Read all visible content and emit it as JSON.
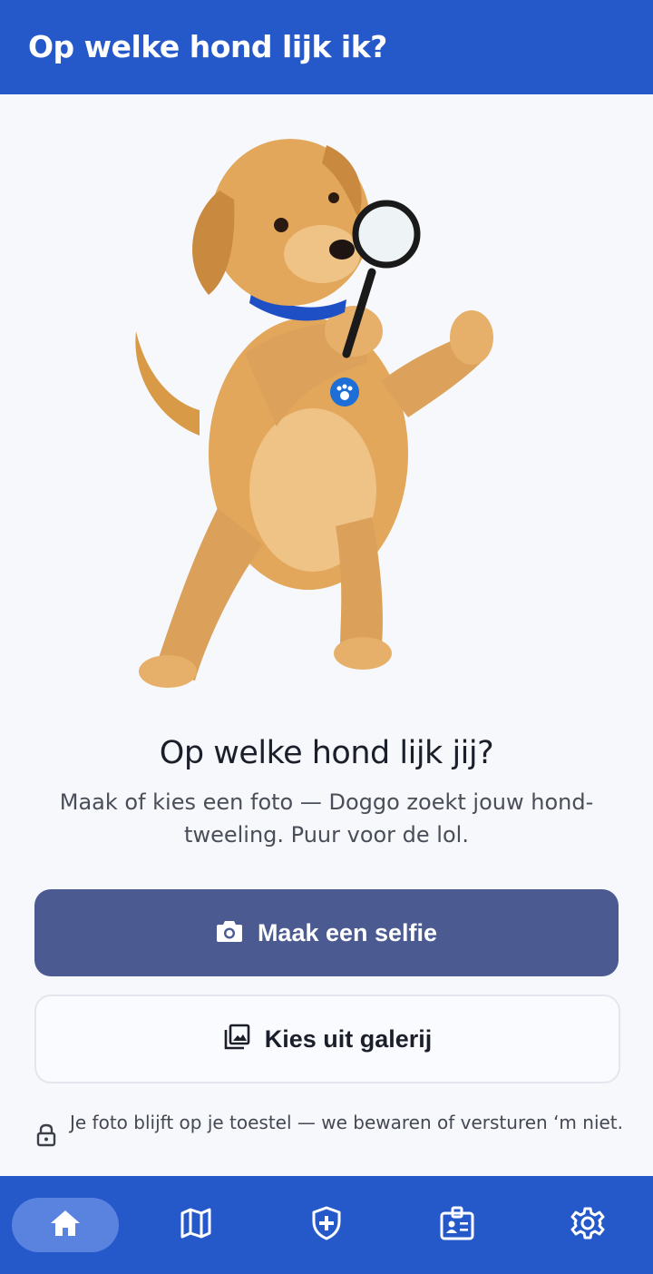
{
  "appbar": {
    "title": "Op welke hond lijk ik?"
  },
  "hero": {
    "image_name": "puppy-with-magnifying-glass"
  },
  "main": {
    "headline": "Op welke hond lijk jij?",
    "subtitle": "Maak of kies een foto — Doggo zoekt jouw hond-tweeling. Puur voor de lol.",
    "primary_button": {
      "label": "Maak een selfie",
      "icon": "camera-icon"
    },
    "secondary_button": {
      "label": "Kies uit galerij",
      "icon": "gallery-icon"
    },
    "privacy_note": {
      "text": "Je foto blijft op je toestel — we bewaren of versturen ‘m niet.",
      "icon": "lock-icon"
    }
  },
  "bottom_nav": {
    "items": [
      {
        "id": "home",
        "icon": "home-icon",
        "active": true
      },
      {
        "id": "map",
        "icon": "map-icon",
        "active": false
      },
      {
        "id": "health",
        "icon": "shield-plus-icon",
        "active": false
      },
      {
        "id": "id-card",
        "icon": "id-badge-icon",
        "active": false
      },
      {
        "id": "settings",
        "icon": "gear-icon",
        "active": false
      }
    ]
  },
  "colors": {
    "brand_blue": "#2558c9",
    "primary_button": "#4b5b92",
    "nav_active_pill": "#5a83e0",
    "background": "#f6f8fc"
  }
}
